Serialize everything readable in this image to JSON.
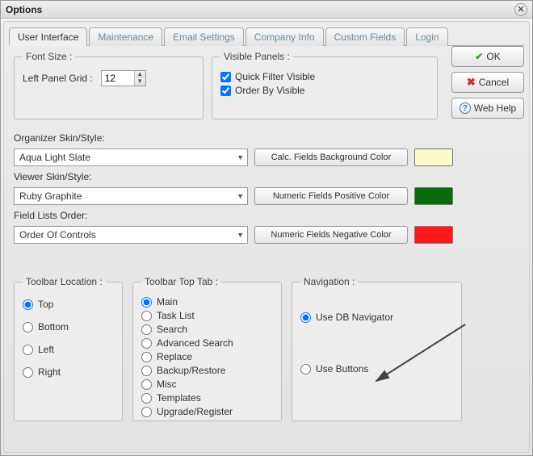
{
  "window": {
    "title": "Options"
  },
  "buttons": {
    "ok": "OK",
    "cancel": "Cancel",
    "webhelp": "Web Help"
  },
  "tabs": [
    "User Interface",
    "Maintenance",
    "Email Settings",
    "Company Info",
    "Custom Fields",
    "Login"
  ],
  "fontsize": {
    "legend": "Font Size :",
    "label": "Left Panel Grid :",
    "value": "12"
  },
  "visiblepanels": {
    "legend": "Visible Panels :",
    "quickfilter": "Quick Filter Visible",
    "orderby": "Order By Visible"
  },
  "skins": {
    "orgLabel": "Organizer Skin/Style:",
    "orgValue": "Aqua Light Slate",
    "viewerLabel": "Viewer Skin/Style:",
    "viewerValue": "Ruby Graphite",
    "fieldListsLabel": "Field Lists Order:",
    "fieldListsValue": "Order Of Controls"
  },
  "colorbtns": {
    "calc": "Calc. Fields Background Color",
    "pos": "Numeric Fields Positive Color",
    "neg": "Numeric Fields Negative Color"
  },
  "colors": {
    "calc": "#fbfbca",
    "pos": "#0a6b0a",
    "neg": "#ff1a1a"
  },
  "toolbarLoc": {
    "legend": "Toolbar Location :",
    "options": [
      "Top",
      "Bottom",
      "Left",
      "Right"
    ]
  },
  "toolbarTab": {
    "legend": "Toolbar Top Tab :",
    "options": [
      "Main",
      "Task List",
      "Search",
      "Advanced Search",
      "Replace",
      "Backup/Restore",
      "Misc",
      "Templates",
      "Upgrade/Register"
    ]
  },
  "navigation": {
    "legend": "Navigation :",
    "db": "Use DB Navigator",
    "buttons": "Use Buttons"
  }
}
